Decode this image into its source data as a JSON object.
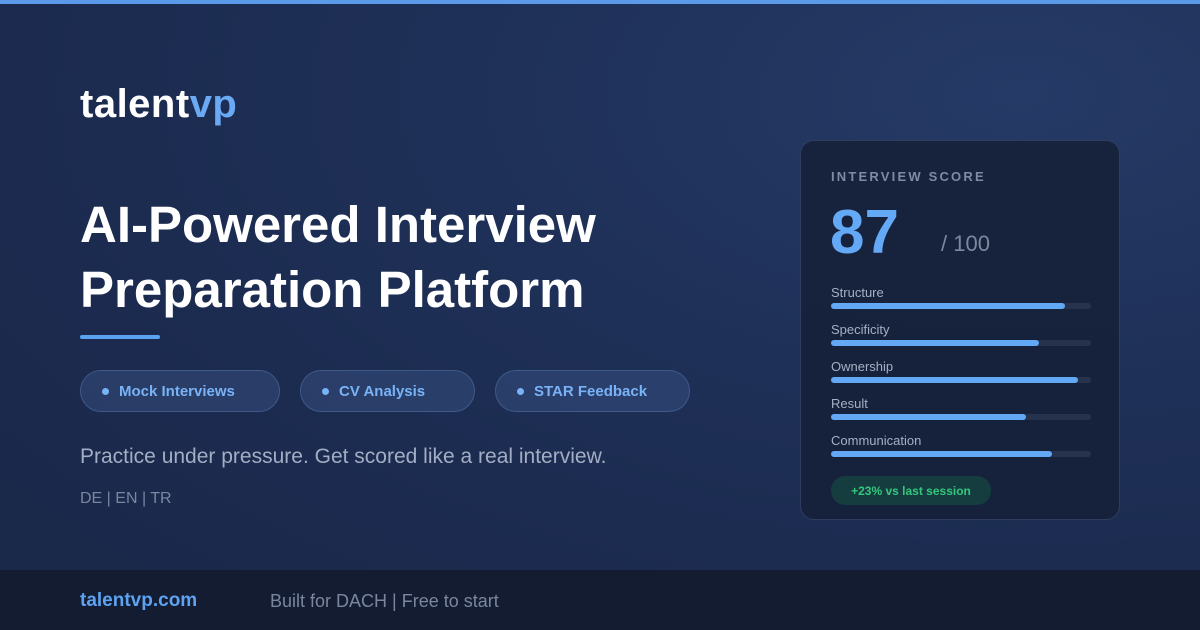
{
  "brand": {
    "name_part1": "talent",
    "name_part2": "vp"
  },
  "hero": {
    "headline_line1": "AI-Powered Interview",
    "headline_line2": "Preparation Platform",
    "features": [
      "Mock Interviews",
      "CV Analysis",
      "STAR Feedback"
    ],
    "tagline": "Practice under pressure. Get scored like a real interview.",
    "languages": "DE | EN | TR"
  },
  "score_card": {
    "title": "INTERVIEW SCORE",
    "score": "87",
    "max": "/ 100",
    "metrics": [
      {
        "label": "Structure",
        "value": 0.9
      },
      {
        "label": "Specificity",
        "value": 0.8
      },
      {
        "label": "Ownership",
        "value": 0.95
      },
      {
        "label": "Result",
        "value": 0.75
      },
      {
        "label": "Communication",
        "value": 0.85
      }
    ],
    "badge": "+23% vs last session"
  },
  "footer": {
    "domain": "talentvp.com",
    "note": "Built for DACH | Free to start"
  },
  "colors": {
    "accent": "#5b9ae8",
    "brand_highlight": "#6aaaf5",
    "positive": "#34c77d",
    "background": "#1b2a4e"
  }
}
